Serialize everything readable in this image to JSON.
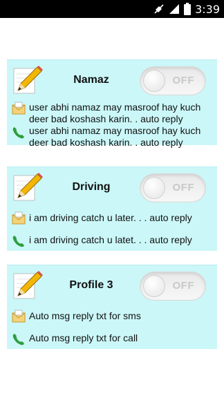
{
  "status_bar": {
    "time": "3:39",
    "icons": [
      "mute-icon",
      "signal-icon",
      "battery-icon"
    ]
  },
  "profiles": [
    {
      "name": "Namaz",
      "toggle_label": "OFF",
      "sms_text": "user abhi namaz may masroof hay kuch deer bad koshash karin. . auto reply",
      "call_text": "user abhi namaz may masroof hay kuch deer bad koshash karin. . auto reply"
    },
    {
      "name": "Driving",
      "toggle_label": "OFF",
      "sms_text": "i am driving catch u later. . . auto reply",
      "call_text": "i am driving catch u latet. . . auto reply"
    },
    {
      "name": "Profile 3",
      "toggle_label": "OFF",
      "sms_text": "Auto msg reply txt for sms",
      "call_text": "Auto msg reply txt for call"
    }
  ],
  "colors": {
    "card_bg": "#cbf7f8",
    "toggle_off_text": "#c8c8c8"
  }
}
